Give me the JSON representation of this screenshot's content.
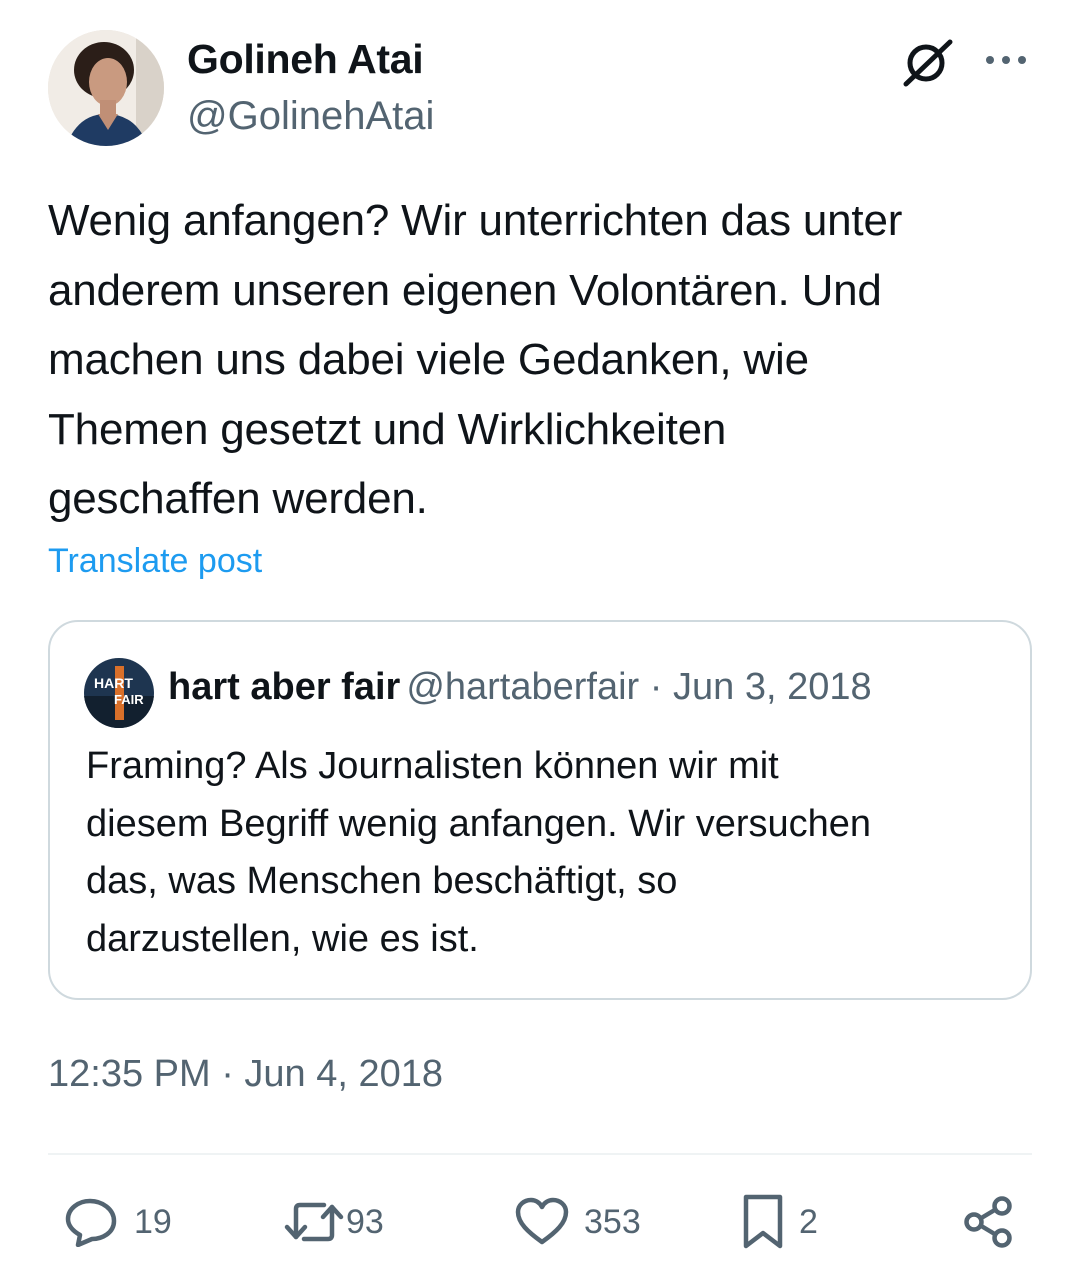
{
  "author": {
    "display_name": "Golineh Atai",
    "handle": "@GolinehAtai",
    "avatar_icon": "profile-photo"
  },
  "header_icons": {
    "grok": "grok-icon",
    "more": "more-options-icon"
  },
  "tweet": {
    "text": "Wenig anfangen? Wir unterrichten das unter\nanderem unseren eigenen Volontären. Und\nmachen uns dabei viele Gedanken, wie\nThemen gesetzt und Wirklichkeiten\ngeschaffen werden.",
    "translate_label": "Translate post",
    "timestamp": "12:35 PM · Jun 4, 2018"
  },
  "quote": {
    "name": "hart aber fair",
    "handle": "@hartaberfair",
    "date": " · Jun 3, 2018",
    "logo_text_1": "HART",
    "logo_text_2": "FAIR",
    "text": "Framing? Als Journalisten können wir mit\ndiesem Begriff wenig anfangen. Wir versuchen\ndas, was Menschen beschäftigt, so\ndarzustellen, wie es ist."
  },
  "actions": {
    "replies": "19",
    "reposts": "93",
    "likes": "353",
    "bookmarks": "2"
  },
  "colors": {
    "text": "#0f1419",
    "secondary": "#536471",
    "link": "#1d9bf0",
    "border": "#cfd9de"
  }
}
